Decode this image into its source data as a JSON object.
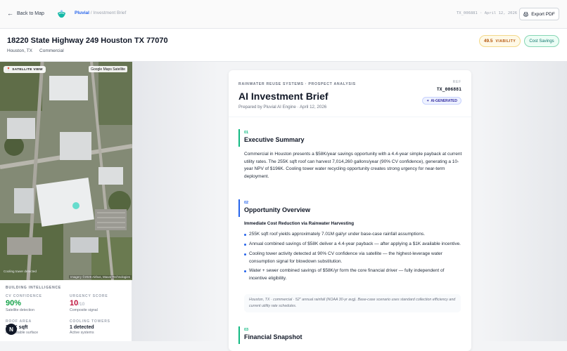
{
  "topbar": {
    "back_label": "Back to Map",
    "brand_name": "Pluvial",
    "brand_suffix": "/ Investment Brief",
    "ref_date": "TX_006881 · April 12, 2026",
    "export_label": "Export PDF"
  },
  "property": {
    "address": "18220 State Highway 249 Houston TX 77070",
    "city": "Houston, TX",
    "type": "Commercial",
    "viability_score": "49.5",
    "viability_label": "VIABILITY",
    "savings_tag": "Cost Savings"
  },
  "map": {
    "badge": "SATELLITE VIEW",
    "source": "Google Maps Satellite",
    "detection": "Cooling tower detected",
    "credit": "Imagery ©2026 Airbus, Maxar Technologies"
  },
  "intel": {
    "title": "BUILDING INTELLIGENCE",
    "cv_label": "CV CONFIDENCE",
    "cv_value": "90%",
    "cv_sub": "Satellite detection",
    "urgency_label": "URGENCY SCORE",
    "urgency_value": "10",
    "urgency_max": "/10",
    "urgency_sub": "Composite signal",
    "roof_label": "ROOF AREA",
    "roof_value": "255K sqft",
    "roof_sub": "Harvestable surface",
    "towers_label": "COOLING TOWERS",
    "towers_value": "1 detected",
    "towers_sub": "Active systems",
    "fab_label": "N"
  },
  "brief": {
    "eyebrow": "RAINWATER REUSE SYSTEMS · PROSPECT ANALYSIS",
    "title": "AI Investment Brief",
    "prepared": "Prepared by Pluvial AI Engine · April 12, 2026",
    "ref_label": "REF",
    "ref_value": "TX_006881",
    "ai_badge": "AI-GENERATED",
    "sections": [
      {
        "num": "01",
        "title": "Executive Summary"
      },
      {
        "num": "02",
        "title": "Opportunity Overview"
      },
      {
        "num": "03",
        "title": "Financial Snapshot"
      }
    ],
    "summary": "Commercial in Houston presents a $58K/year savings opportunity with a 4.4-year simple payback at current utility rates. The 255K sqft roof can harvest 7,014,260 gallons/year (90% CV confidence), generating a 10-year NPV of $196K. Cooling tower water recycling opportunity creates strong urgency for near-term deployment.",
    "opp_subhead": "Immediate Cost Reduction via Rainwater Harvesting",
    "bullets": [
      "255K sqft roof yields approximately 7.01M gal/yr under base-case rainfall assumptions.",
      "Annual combined savings of $58K deliver a 4.4-year payback — after applying a $1K available incentive.",
      "Cooling tower activity detected at 90% CV confidence via satellite — the highest-leverage water consumption signal for blowdown substitution.",
      "Water + sewer combined savings of $58K/yr form the core financial driver — fully independent of incentive eligibility."
    ],
    "note": "Houston, TX · commercial · 52\" annual rainfall (NOAA 30-yr avg). Base-case scenario uses standard collection efficiency and current utility rate schedules."
  },
  "colors": {
    "accent_green": "#16a34a",
    "accent_blue": "#2563eb",
    "urgency_red": "#be123c"
  }
}
